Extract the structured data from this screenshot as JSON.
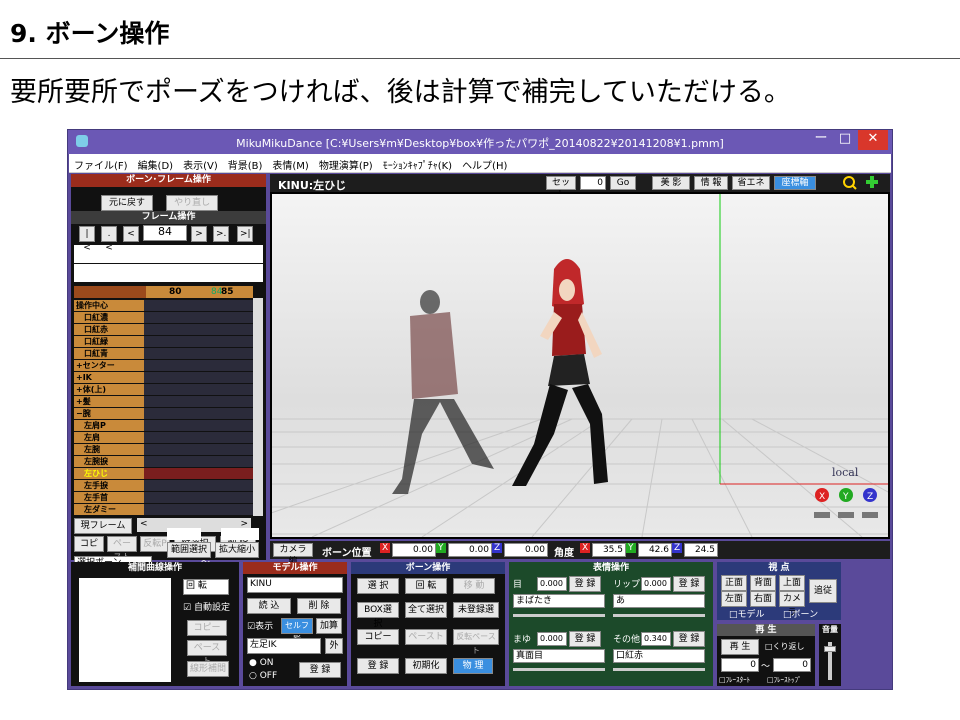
{
  "slide": {
    "title": "9. ボーン操作",
    "subtitle": "要所要所でポーズをつければ、後は計算で補完していただける。"
  },
  "window": {
    "title": "MikuMikuDance [C:¥Users¥m¥Desktop¥box¥作ったパワポ_20140822¥20141208¥1.pmm]",
    "min": "ー",
    "max": "□",
    "close": "✕"
  },
  "menu": [
    "ファイル(F)",
    "編集(D)",
    "表示(V)",
    "背景(B)",
    "表情(M)",
    "物理演算(P)",
    "ﾓｰｼｮﾝｷｬﾌﾟﾁｬ(K)",
    "ヘルプ(H)"
  ],
  "bone_frame": {
    "title": "ボーン･フレーム操作",
    "undo": "元に戻す",
    "redo": "やり直し"
  },
  "frame_op": {
    "title": "フレーム操作",
    "frame": "84",
    "b_first": "|<",
    "b_prevkey": ".<",
    "b_prev": "<",
    "b_next": ">",
    "b_nextkey": ">.",
    "b_last": ">|"
  },
  "timeline": {
    "marks": [
      "80",
      "84",
      "85"
    ],
    "rows": [
      "操作中心",
      "口紅濃",
      "口紅赤",
      "口紅緑",
      "口紅青",
      "+センター",
      "+IK",
      "+体(上)",
      "+髪",
      "−腕",
      "左肩P",
      "左肩",
      "左腕",
      "左腕捩",
      "左ひじ",
      "左手捩",
      "左手首",
      "左ダミー"
    ],
    "selected_row": "左ひじ"
  },
  "left_bottom": {
    "current_frame": "現フレーム",
    "left": "<",
    "right": ">",
    "copy": "コピー",
    "paste": "ペースト",
    "reverse": "反転P",
    "vsel": "縦選択",
    "del": "削 除",
    "select_bone": "選択ボーン",
    "tilde": "〜",
    "range": "範囲選択",
    "scale": "拡大縮小"
  },
  "viewport": {
    "bone_name": "KINU:左ひじ",
    "set": "セット",
    "set_frame": "0",
    "go": "Go",
    "buttons": [
      "美 影",
      "情 報",
      "省エネ",
      "座標軸"
    ],
    "local": "local",
    "axis_labels": [
      "X",
      "Y",
      "Z"
    ]
  },
  "bonebar": {
    "camera": "カメラ編",
    "pos_label": "ボーン位置",
    "x_label": "X",
    "x": "0.00",
    "y_label": "Y",
    "y": "0.00",
    "z_label": "Z",
    "z": "0.00",
    "angle_label": "角度",
    "ax": "35.5",
    "ay": "42.6",
    "az": "24.5"
  },
  "interp": {
    "title": "補間曲線操作",
    "rotate": "回 転",
    "auto": "自動設定",
    "copy": "コピー",
    "paste": "ペースト",
    "linear": "線形補間"
  },
  "model": {
    "title": "モデル操作",
    "model": "KINU",
    "load": "読 込",
    "delete": "削 除",
    "show": "表示",
    "self_shadow": "セルフ影",
    "add": "加算",
    "bone": "左足IK",
    "ext": "外",
    "on": "ON",
    "off": "OFF",
    "register": "登 録"
  },
  "bone_op": {
    "title": "ボーン操作",
    "select": "選 択",
    "rotate": "回 転",
    "move": "移 動",
    "box": "BOX選択",
    "all": "全て選択",
    "unreg": "未登録選",
    "copy": "コピー",
    "paste": "ペースト",
    "revpaste": "反転ペースト",
    "register": "登 録",
    "init": "初期化",
    "physics": "物 理"
  },
  "face": {
    "title": "表情操作",
    "eye_label": "目",
    "eye_val": "0.000",
    "eye_morph": "まばたき",
    "lip_label": "リップ",
    "lip_val": "0.000",
    "lip_morph": "あ",
    "brow_label": "まゆ",
    "brow_val": "0.000",
    "brow_morph": "真面目",
    "other_label": "その他",
    "other_val": "0.340",
    "other_morph": "口紅赤",
    "register": "登 録"
  },
  "view": {
    "title": "視 点",
    "front": "正面",
    "back": "背面",
    "top": "上面",
    "follow": "追従",
    "left": "左面",
    "right": "右面",
    "camera": "カメラ",
    "model": "モデル",
    "bone": "ボーン"
  },
  "play": {
    "title": "再 生",
    "play": "再 生",
    "repeat": "くり返し",
    "from": "0",
    "tilde": "〜",
    "to": "0",
    "fstart": "ﾌﾚｰｽﾀｰﾄ",
    "fstop": "ﾌﾚｰｽﾄｯﾌﾟ"
  },
  "volume": {
    "title": "音量"
  }
}
